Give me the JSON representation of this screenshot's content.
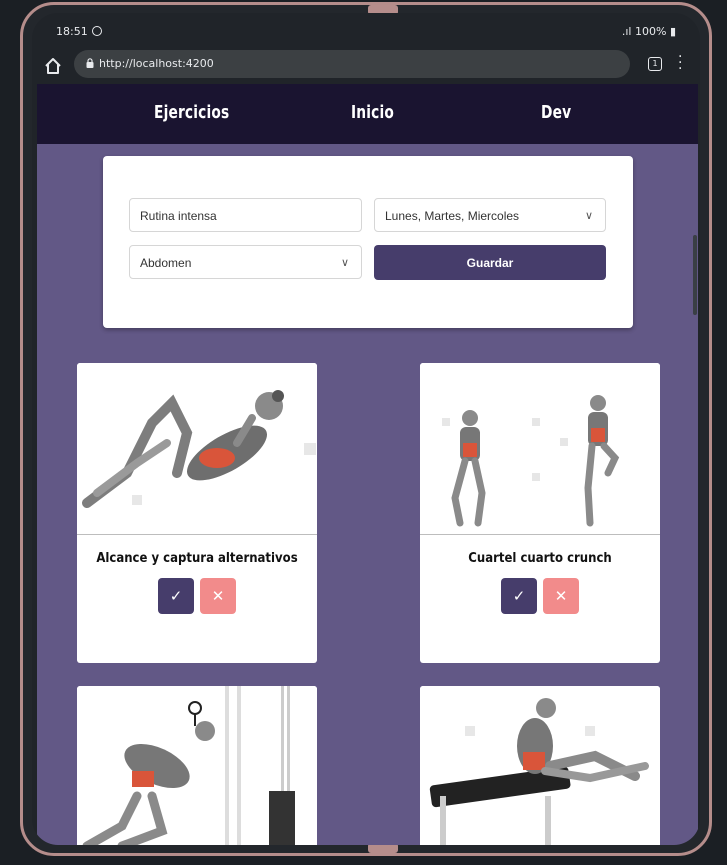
{
  "status_bar": {
    "time": "18:51",
    "battery": "100%"
  },
  "browser": {
    "url": "http://localhost:4200",
    "tab_count": "1"
  },
  "nav": {
    "items": [
      {
        "label": "Ejercicios"
      },
      {
        "label": "Inicio"
      },
      {
        "label": "Dev"
      }
    ]
  },
  "form": {
    "routine_name": "Rutina intensa",
    "days": "Lunes, Martes, Miercoles",
    "muscle_group": "Abdomen",
    "save_label": "Guardar"
  },
  "exercises": [
    {
      "title": "Alcance y captura alternativos",
      "ok_icon": "check-icon",
      "remove_icon": "close-icon"
    },
    {
      "title": "Cuartel cuarto crunch",
      "ok_icon": "check-icon",
      "remove_icon": "close-icon"
    },
    {
      "title": "",
      "ok_icon": "check-icon",
      "remove_icon": "close-icon"
    },
    {
      "title": "",
      "ok_icon": "check-icon",
      "remove_icon": "close-icon"
    }
  ],
  "colors": {
    "page_bg": "#625886",
    "nav_bg": "#1a1430",
    "primary": "#463d6b",
    "danger": "#f28b8b",
    "muscle_highlight": "#d9553a"
  }
}
